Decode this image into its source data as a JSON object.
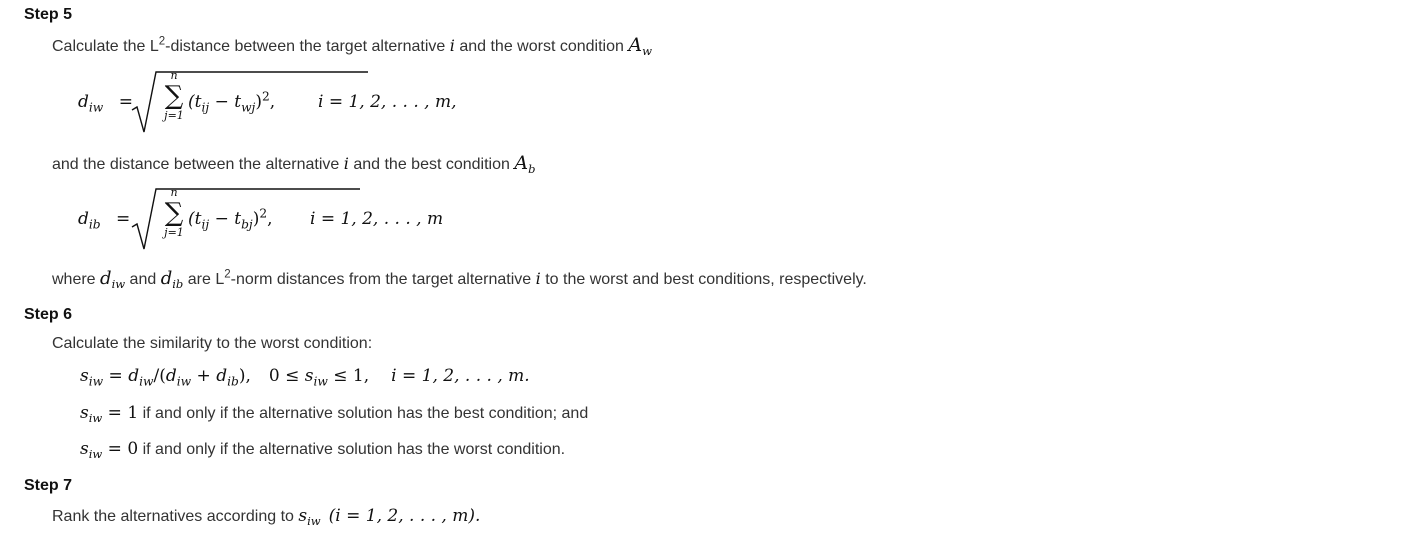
{
  "step5": {
    "heading": "Step 5",
    "intro_text": "Calculate the L",
    "intro_sup": "2",
    "intro_text2": "-distance between the target alternative ",
    "intro_var": "i",
    "intro_text3": " and the worst condition ",
    "intro_A": "A",
    "intro_A_sub": "w",
    "eq1": {
      "lhs_var": "d",
      "lhs_sub": "iw",
      "eq_sign": "=",
      "sum_top": "n",
      "sum_bottom": "j=1",
      "body": "(t",
      "body_sub1": "ij",
      "minus": " − t",
      "body_sub2": "wj",
      "close": ")",
      "power": "2",
      "comma": ",",
      "cond": "i = 1, 2, . . . , m,"
    },
    "mid_text": "and the distance between the alternative ",
    "mid_var": "i",
    "mid_text2": " and the best condition ",
    "mid_A": "A",
    "mid_A_sub": "b",
    "eq2": {
      "lhs_var": "d",
      "lhs_sub": "ib",
      "eq_sign": "=",
      "sum_top": "n",
      "sum_bottom": "j=1",
      "body": "(t",
      "body_sub1": "ij",
      "minus": " − t",
      "body_sub2": "bj",
      "close": ")",
      "power": "2",
      "comma": ",",
      "cond": "i = 1, 2, . . . , m"
    },
    "where_text1": "where ",
    "where_d1": "d",
    "where_d1_sub": "iw",
    "where_text2": " and ",
    "where_d2": "d",
    "where_d2_sub": "ib",
    "where_text3": " are L",
    "where_sup": "2",
    "where_text4": "-norm distances from the target alternative ",
    "where_var": "i",
    "where_text5": " to the worst and best conditions, respectively."
  },
  "step6": {
    "heading": "Step 6",
    "intro": "Calculate the similarity to the worst condition:",
    "f1_s": "s",
    "f1_s_sub": "iw",
    "f1_eq": " = ",
    "f1_d1": "d",
    "f1_d1_sub": "iw",
    "f1_slash": "/(",
    "f1_d2": "d",
    "f1_d2_sub": "iw",
    "f1_plus": " + ",
    "f1_d3": "d",
    "f1_d3_sub": "ib",
    "f1_close": "),",
    "f1_bound": "0 ≤ ",
    "f1_s2": "s",
    "f1_s2_sub": "iw",
    "f1_bound2": " ≤ 1,",
    "f1_range": "i = 1, 2, . . . , m.",
    "f2_s": "s",
    "f2_s_sub": "iw",
    "f2_eq": " = 1",
    "f2_text": " if and only if the alternative solution has the best condition; and",
    "f3_s": "s",
    "f3_s_sub": "iw",
    "f3_eq": " = 0",
    "f3_text": " if and only if the alternative solution has the worst condition."
  },
  "step7": {
    "heading": "Step 7",
    "text": "Rank the alternatives according to ",
    "s": "s",
    "s_sub": "iw",
    "range": "(i = 1, 2, . . . , m)."
  }
}
